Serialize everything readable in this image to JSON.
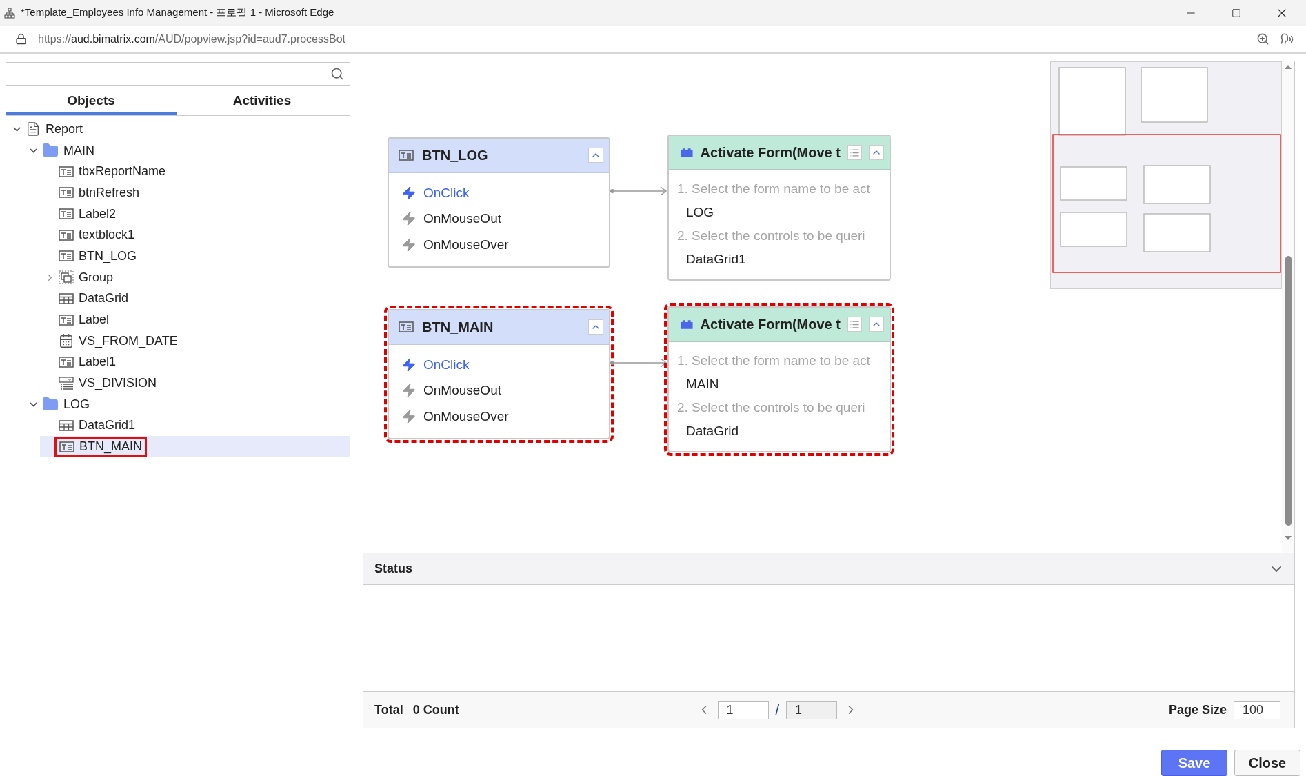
{
  "window": {
    "title": "*Template_Employees Info Management - 프로필 1 - Microsoft Edge"
  },
  "address_bar": {
    "url_prefix": "https://",
    "url_host": "aud.bimatrix.com",
    "url_path": "/AUD/popview.jsp?id=aud7.processBot"
  },
  "sidebar": {
    "tabs": [
      {
        "label": "Objects",
        "selected": true
      },
      {
        "label": "Activities",
        "selected": false
      }
    ],
    "tree": [
      {
        "label": "Report",
        "kind": "doc",
        "expanded": true,
        "selected": false,
        "annotated": false,
        "children": [
          {
            "label": "MAIN",
            "kind": "folder",
            "expanded": true,
            "selected": false,
            "annotated": false,
            "children": [
              {
                "label": "tbxReportName",
                "kind": "text",
                "selected": false,
                "annotated": false
              },
              {
                "label": "btnRefresh",
                "kind": "text",
                "selected": false,
                "annotated": false
              },
              {
                "label": "Label2",
                "kind": "text",
                "selected": false,
                "annotated": false
              },
              {
                "label": "textblock1",
                "kind": "text",
                "selected": false,
                "annotated": false
              },
              {
                "label": "BTN_LOG",
                "kind": "text",
                "selected": false,
                "annotated": false
              },
              {
                "label": "Group",
                "kind": "group",
                "expanded": false,
                "selected": false,
                "annotated": false
              },
              {
                "label": "DataGrid",
                "kind": "grid",
                "selected": false,
                "annotated": false
              },
              {
                "label": "Label",
                "kind": "text",
                "selected": false,
                "annotated": false
              },
              {
                "label": "VS_FROM_DATE",
                "kind": "calendar",
                "selected": false,
                "annotated": false
              },
              {
                "label": "Label1",
                "kind": "text",
                "selected": false,
                "annotated": false
              },
              {
                "label": "VS_DIVISION",
                "kind": "combo",
                "selected": false,
                "annotated": false
              }
            ]
          },
          {
            "label": "LOG",
            "kind": "folder",
            "expanded": true,
            "selected": false,
            "annotated": false,
            "children": [
              {
                "label": "DataGrid1",
                "kind": "grid",
                "selected": false,
                "annotated": false
              },
              {
                "label": "BTN_MAIN",
                "kind": "text",
                "selected": true,
                "annotated": true
              }
            ]
          }
        ]
      }
    ]
  },
  "flows": [
    {
      "trigger": {
        "title": "BTN_LOG",
        "annotated": false,
        "events": [
          {
            "label": "OnClick",
            "active": true
          },
          {
            "label": "OnMouseOut",
            "active": false
          },
          {
            "label": "OnMouseOver",
            "active": false
          }
        ]
      },
      "action": {
        "title": "Activate Form(Move t",
        "annotated": false,
        "steps": [
          {
            "label": "1. Select the form name to be act",
            "value": "LOG"
          },
          {
            "label": "2. Select the controls to be queri",
            "value": "DataGrid1"
          }
        ]
      }
    },
    {
      "trigger": {
        "title": "BTN_MAIN",
        "annotated": true,
        "events": [
          {
            "label": "OnClick",
            "active": true
          },
          {
            "label": "OnMouseOut",
            "active": false
          },
          {
            "label": "OnMouseOver",
            "active": false
          }
        ]
      },
      "action": {
        "title": "Activate Form(Move t",
        "annotated": true,
        "steps": [
          {
            "label": "1. Select the form name to be act",
            "value": "MAIN"
          },
          {
            "label": "2. Select the controls to be queri",
            "value": "DataGrid"
          }
        ]
      }
    }
  ],
  "status": {
    "title": "Status",
    "total_label": "Total",
    "total_value": "0 Count",
    "page": "1",
    "separator": "/",
    "page_count": "1",
    "page_size_label": "Page Size",
    "page_size": "100"
  },
  "buttons": [
    {
      "label": "Save",
      "kind": "primary"
    },
    {
      "label": "Close",
      "kind": "secondary"
    }
  ]
}
